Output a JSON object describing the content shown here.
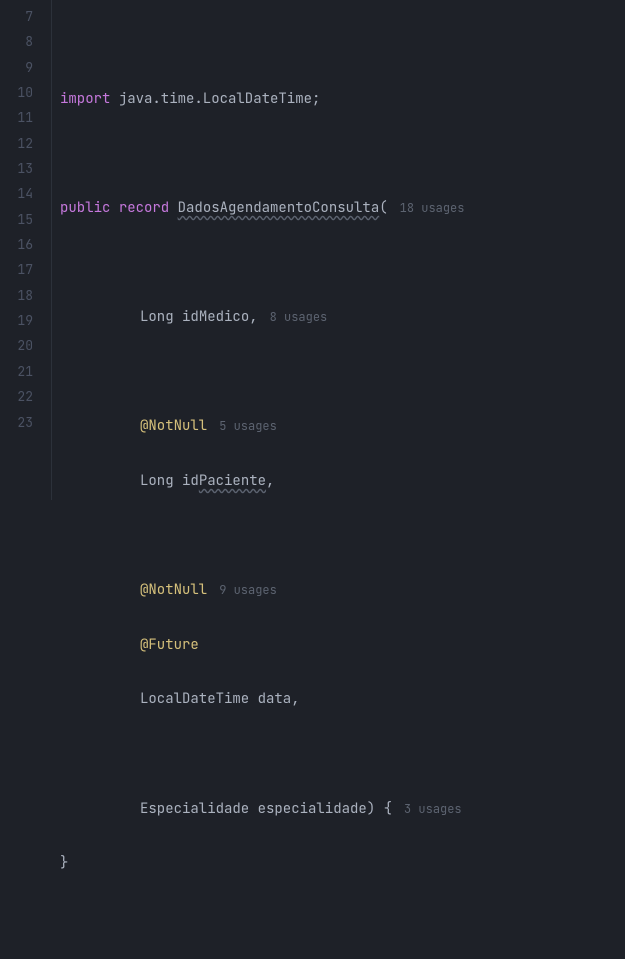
{
  "gutter": {
    "start": 7,
    "end": 23
  },
  "lines": {
    "l8": {
      "kw": "import",
      "pkg": "java.time.LocalDateTime",
      "semi": ";"
    },
    "l10": {
      "kw1": "public",
      "kw2": "record",
      "name": "DadosAgendamentoConsulta",
      "paren": "(",
      "hint": "18 usages"
    },
    "l12": {
      "type": "Long",
      "ident": "idMedico",
      "comma": ",",
      "hint": "8 usages"
    },
    "l14": {
      "annotation": "@NotNull",
      "hint": "5 usages"
    },
    "l15": {
      "type": "Long",
      "identPrefix": "id",
      "identUnderline": "Paciente",
      "comma": ","
    },
    "l17": {
      "annotation": "@NotNull",
      "hint": "9 usages"
    },
    "l18": {
      "annotation": "@Future"
    },
    "l19": {
      "type": "LocalDateTime",
      "ident": "data",
      "comma": ","
    },
    "l21": {
      "type": "Especialidade",
      "ident": "especialidade",
      "close": ") {",
      "hint": "3 usages"
    },
    "l22": {
      "brace": "}"
    }
  }
}
